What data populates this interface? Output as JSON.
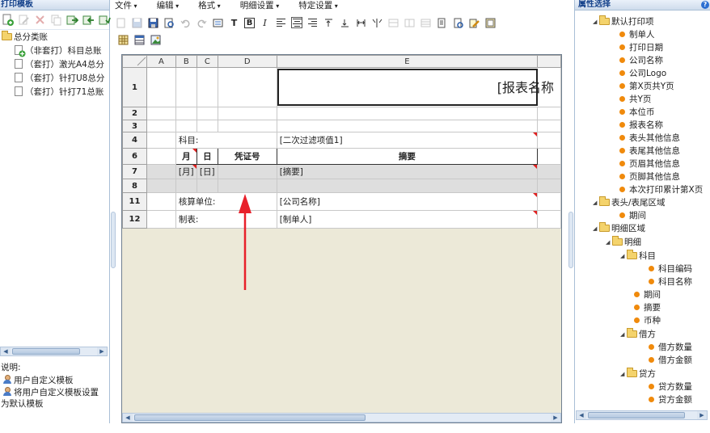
{
  "left_panel": {
    "title": "打印模板",
    "tree": {
      "root": "总分类账",
      "items": [
        "（非套打）科目总账",
        "（套打）激光A4总分",
        "（套打）针打U8总分",
        "（套打）针打71总账"
      ]
    },
    "notes": {
      "label": "说明:",
      "line1": "用户自定义模板",
      "line2a": "将用户自定义模板设置",
      "line2b": "为默认模板"
    }
  },
  "menu": {
    "file": "文件",
    "edit": "编辑",
    "format": "格式",
    "detail": "明细设置",
    "special": "特定设置"
  },
  "toolbar": {
    "text_tool": "T",
    "bold": "B",
    "italic": "I"
  },
  "sheet": {
    "columns": [
      "A",
      "B",
      "C",
      "D",
      "E"
    ],
    "rows": [
      "1",
      "2",
      "3",
      "4",
      "6",
      "7",
      "8",
      "11",
      "12"
    ],
    "title_placeholder": "[报表名称",
    "r4_label": "科目:",
    "r4_value": "[二次过滤项值1]",
    "r6_month": "月",
    "r6_day": "日",
    "r6_voucher": "凭证号",
    "r6_summary": "摘要",
    "r7_month": "[月]",
    "r7_day": "[日]",
    "r7_summary": "[摘要]",
    "r11_label": "核算单位:",
    "r11_value": "[公司名称]",
    "r12_label": "制表:",
    "r12_value": "[制单人]"
  },
  "right_panel": {
    "title": "属性选择",
    "help": "?",
    "default_print": "默认打印项",
    "default_items": [
      "制单人",
      "打印日期",
      "公司名称",
      "公司Logo",
      "第X页共Y页",
      "共Y页",
      "本位币",
      "报表名称",
      "表头其他信息",
      "表尾其他信息",
      "页眉其他信息",
      "页脚其他信息",
      "本次打印累计第X页"
    ],
    "header_footer": "表头/表尾区域",
    "header_items": [
      "期间"
    ],
    "detail_area": "明细区域",
    "detail": "明细",
    "subject": "科目",
    "subject_items": [
      "科目编码",
      "科目名称"
    ],
    "detail_items": [
      "期间",
      "摘要",
      "币种"
    ],
    "debit": "借方",
    "debit_items": [
      "借方数量",
      "借方金额"
    ],
    "credit": "贷方",
    "credit_items": [
      "贷方数量",
      "贷方金额"
    ]
  },
  "colors": {
    "accent": "#15428b",
    "arrow": "#e8202a",
    "tree_dot": "#f08a0c",
    "sheet_bg": "#ece9d8"
  },
  "icons": [
    "new-icon",
    "edit-icon",
    "delete-icon",
    "copy-icon",
    "export-icon",
    "import-icon",
    "folder-icon",
    "page-icon",
    "user-icon",
    "settings-icon"
  ]
}
